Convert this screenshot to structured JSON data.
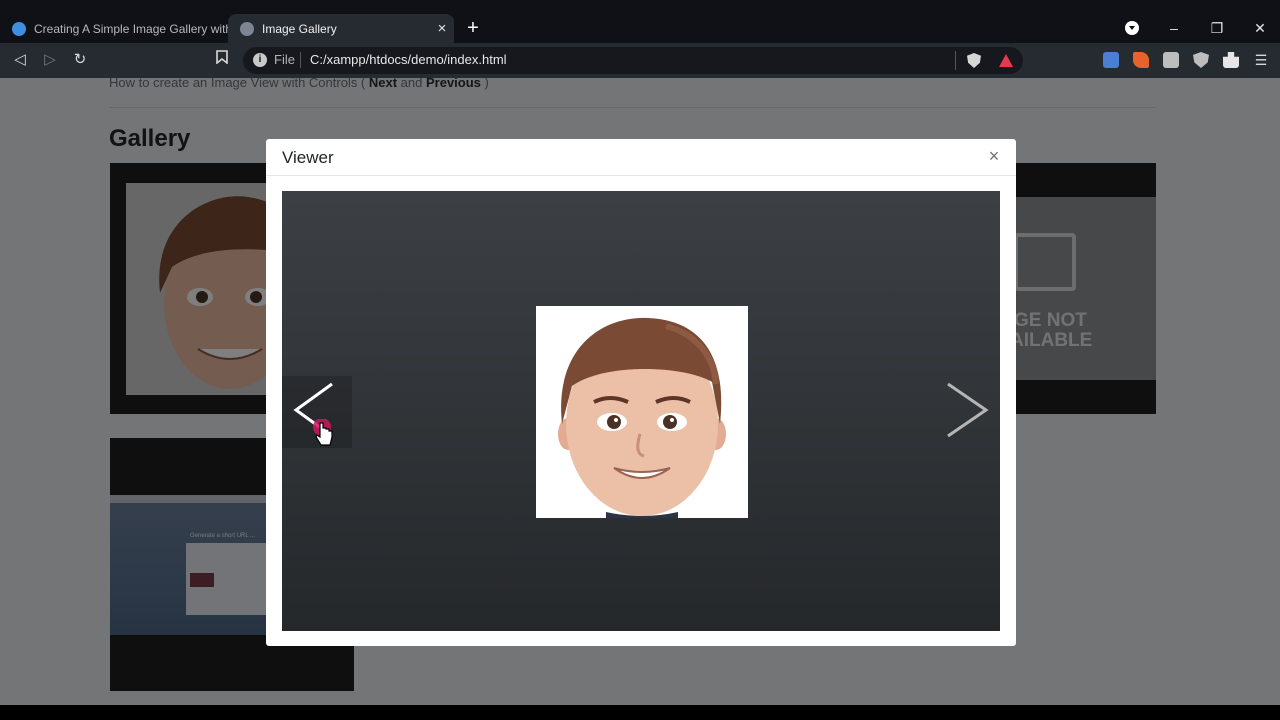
{
  "browser": {
    "tabs": [
      {
        "title": "Creating A Simple Image Gallery with"
      },
      {
        "title": "Image Gallery",
        "close": "×"
      }
    ],
    "new_tab": "+",
    "window_controls": {
      "minimize": "–",
      "restore": "❐",
      "close": "✕"
    },
    "nav": {
      "back": "◁",
      "forward": "▷",
      "reload": "↻",
      "bookmark": "🔖"
    },
    "address": {
      "info": "i",
      "scheme": "File",
      "url": "C:/xampp/htdocs/demo/index.html"
    },
    "menu": "☰",
    "extensions": [
      "translate-icon",
      "swift-icon",
      "camera-icon",
      "shield-icon",
      "puzzle-icon"
    ]
  },
  "page": {
    "subtitle_pre": "How to create an Image View with Controls ( ",
    "subtitle_next": "Next",
    "subtitle_and": " and ",
    "subtitle_prev": "Previous",
    "subtitle_post": " )",
    "heading": "Gallery",
    "not_available_line1": "GE NOT",
    "not_available_line2": "AILABLE",
    "thumb2_card_title": "Generate a short URL ..."
  },
  "viewer": {
    "title": "Viewer",
    "close": "×"
  },
  "colors": {
    "page_bg": "#e9eaec",
    "stage_top": "#3c4044",
    "stage_bottom": "#25282b",
    "hair": "#7a4a35",
    "skin": "#e8b8a0",
    "cursor_highlight": "#d0155f"
  }
}
